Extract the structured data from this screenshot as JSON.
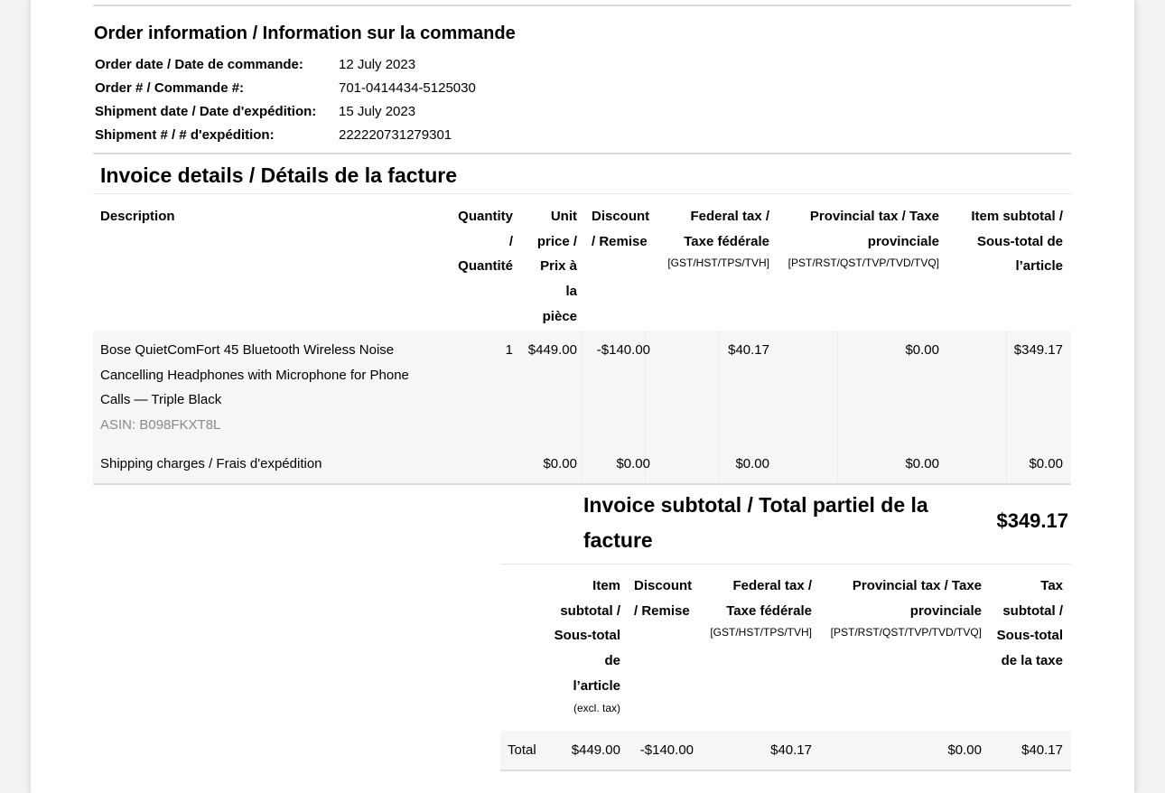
{
  "order_info": {
    "title": "Order information / Information sur la commande",
    "rows": [
      {
        "label": "Order date / Date de commande:",
        "value": "12 July 2023"
      },
      {
        "label": "Order # / Commande #:",
        "value": "701-0414434-5125030"
      },
      {
        "label": "Shipment date / Date d'expédition:",
        "value": "15 July 2023"
      },
      {
        "label": "Shipment # / # d'expédition:",
        "value": "222220731279301"
      }
    ]
  },
  "invoice": {
    "title": "Invoice details / Détails de la facture",
    "headers": {
      "description": "Description",
      "quantity": [
        "Quantity",
        "/",
        "Quantité"
      ],
      "unit_price": [
        "Unit",
        "price /",
        "Prix à",
        "la",
        "pièce"
      ],
      "discount": [
        "Discount",
        "/ Remise"
      ],
      "federal": [
        "Federal tax /",
        "Taxe fédérale"
      ],
      "federal_small": "[GST/HST/TPS/TVH]",
      "provincial": [
        "Provincial tax / Taxe",
        "provinciale"
      ],
      "provincial_small": "[PST/RST/QST/TVP/TVD/TVQ]",
      "item_subtotal": [
        "Item subtotal /",
        "Sous-total de",
        "l’article"
      ]
    },
    "item": {
      "description": [
        "Bose QuietComFort 45 Bluetooth Wireless Noise",
        "Cancelling Headphones with Microphone for Phone",
        "Calls — Triple Black"
      ],
      "asin": "ASIN: B098FKXT8L",
      "quantity": "1",
      "unit_price": "$449.00",
      "discount": "-$140.00",
      "federal": "$40.17",
      "provincial": "$0.00",
      "subtotal": "$349.17"
    },
    "shipping": {
      "label": "Shipping charges / Frais d'expédition",
      "unit_price": "$0.00",
      "discount": "$0.00",
      "federal": "$0.00",
      "provincial": "$0.00",
      "subtotal": "$0.00"
    }
  },
  "summary": {
    "title": "Invoice subtotal / Total partiel de la facture",
    "amount": "$349.17",
    "headers": {
      "item_subtotal": [
        "Item",
        "subtotal /",
        "Sous-total",
        "de",
        "l’article"
      ],
      "item_subtotal_small": "(excl. tax)",
      "discount": [
        "Discount",
        "/ Remise"
      ],
      "federal": [
        "Federal tax /",
        "Taxe fédérale"
      ],
      "federal_small": "[GST/HST/TPS/TVH]",
      "provincial": [
        "Provincial tax / Taxe",
        "provinciale"
      ],
      "provincial_small": "[PST/RST/QST/TVP/TVD/TVQ]",
      "tax_subtotal": [
        "Tax",
        "subtotal /",
        "Sous-total",
        "de la taxe"
      ]
    },
    "total": {
      "label": "Total",
      "item_subtotal": "$449.00",
      "discount": "-$140.00",
      "federal": "$40.17",
      "provincial": "$0.00",
      "tax_subtotal": "$40.17"
    }
  }
}
